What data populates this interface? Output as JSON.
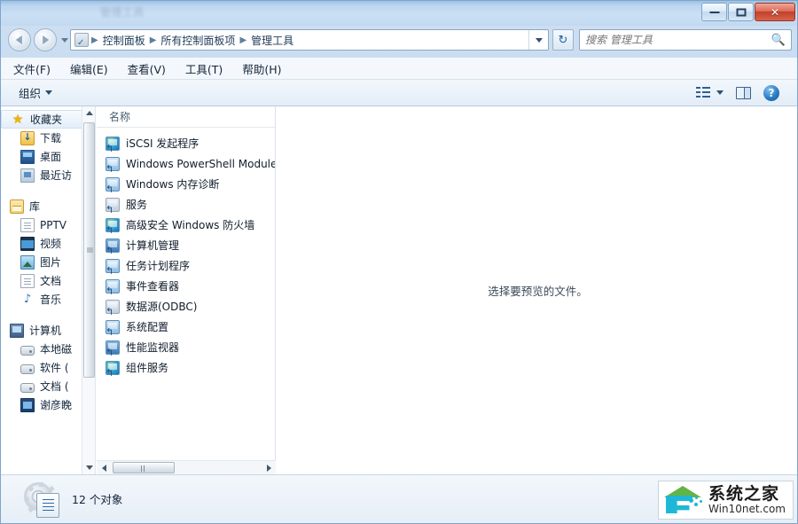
{
  "window": {
    "title_blurred": "管理工具",
    "controls": {
      "minimize": "最小化",
      "maximize": "最大化",
      "close": "✕"
    }
  },
  "navigation": {
    "back_label": "后退",
    "forward_label": "前进",
    "history_label": "最近浏览的位置",
    "refresh_label": "↻",
    "breadcrumb": [
      "控制面板",
      "所有控制面板项",
      "管理工具"
    ],
    "separator": "▶",
    "dropdown_label": "地址下拉"
  },
  "search": {
    "placeholder": "搜索 管理工具",
    "value": "",
    "icon": "search-icon"
  },
  "menubar": {
    "items": [
      {
        "label": "文件(F)"
      },
      {
        "label": "编辑(E)"
      },
      {
        "label": "查看(V)"
      },
      {
        "label": "工具(T)"
      },
      {
        "label": "帮助(H)"
      }
    ]
  },
  "toolbar": {
    "organize_label": "组织",
    "view_options_label": "更改您的视图",
    "preview_pane_label": "显示预览窗格",
    "help_label": "?"
  },
  "sidebar": {
    "groups": [
      {
        "header": {
          "label": "收藏夹",
          "icon": "star-icon",
          "selected": true
        },
        "items": [
          {
            "label": "下载",
            "icon": "download-folder-icon"
          },
          {
            "label": "桌面",
            "icon": "desktop-icon"
          },
          {
            "label": "最近访",
            "icon": "recent-places-icon"
          }
        ]
      },
      {
        "header": {
          "label": "库",
          "icon": "library-icon",
          "selected": false
        },
        "items": [
          {
            "label": "PPTV",
            "icon": "folder-icon"
          },
          {
            "label": "视频",
            "icon": "video-icon"
          },
          {
            "label": "图片",
            "icon": "pictures-icon"
          },
          {
            "label": "文档",
            "icon": "documents-icon"
          },
          {
            "label": "音乐",
            "icon": "music-icon"
          }
        ]
      },
      {
        "header": {
          "label": "计算机",
          "icon": "computer-icon",
          "selected": false
        },
        "items": [
          {
            "label": "本地磁",
            "icon": "drive-icon"
          },
          {
            "label": "软件 (",
            "icon": "drive-icon"
          },
          {
            "label": "文档 (",
            "icon": "drive-icon"
          },
          {
            "label": "谢彦睌",
            "icon": "network-drive-icon"
          }
        ]
      }
    ]
  },
  "filelist": {
    "column_header": "名称",
    "items": [
      {
        "name": "iSCSI 发起程序",
        "icon": "shortcut-globe-icon"
      },
      {
        "name": "Windows PowerShell Module",
        "icon": "shortcut-icon"
      },
      {
        "name": "Windows 内存诊断",
        "icon": "shortcut-icon"
      },
      {
        "name": "服务",
        "icon": "shortcut-grey-icon"
      },
      {
        "name": "高级安全 Windows 防火墙",
        "icon": "shortcut-globe-icon"
      },
      {
        "name": "计算机管理",
        "icon": "shortcut-deep-icon"
      },
      {
        "name": "任务计划程序",
        "icon": "shortcut-icon"
      },
      {
        "name": "事件查看器",
        "icon": "shortcut-icon"
      },
      {
        "name": "数据源(ODBC)",
        "icon": "shortcut-grey-icon"
      },
      {
        "name": "系统配置",
        "icon": "shortcut-icon"
      },
      {
        "name": "性能监视器",
        "icon": "shortcut-deep-icon"
      },
      {
        "name": "组件服务",
        "icon": "shortcut-globe-icon"
      }
    ]
  },
  "preview": {
    "empty_text": "选择要预览的文件。"
  },
  "status": {
    "text": "12 个对象",
    "icon": "admin-tools-icon"
  },
  "watermark": {
    "chinese": "系统之家",
    "english": "Win10net.com"
  },
  "colors": {
    "accent": "#2f6ba8",
    "close_button": "#c0402c",
    "title_gradient_top": "#9cc0e4",
    "watermark_cyan": "#1fb7d8",
    "watermark_green": "#62b445"
  }
}
